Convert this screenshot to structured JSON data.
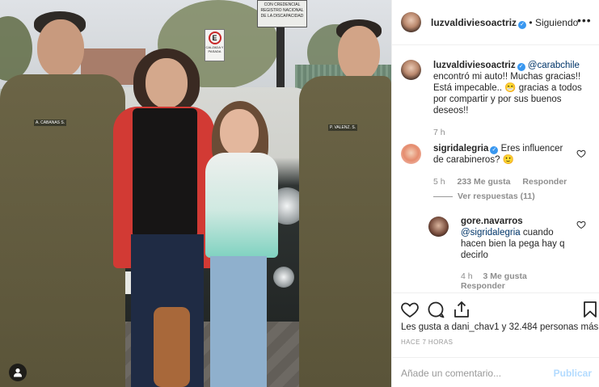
{
  "post": {
    "username": "luzvaldiviesoactriz",
    "follow_separator": "•",
    "follow_label": "Siguiendo",
    "more_glyph": "•••",
    "caption_mention": "@carabchile",
    "caption_text": "encontró mi auto!! Muchas gracias!! Está impecable.. 😁 gracias a todos por compartir y por sus buenos deseos!!",
    "caption_time": "7 h"
  },
  "photo": {
    "sign_text": "CON CREDENCIAL REGISTRO NACIONAL DE LA DISCAPACIDAD",
    "no_parking_letter": "E",
    "no_parking_text": "CALZADA Y PASADA",
    "badge_left": "A. CABANAS S.",
    "badge_right": "P. VALENZ. S."
  },
  "comments": [
    {
      "username": "sigridalegria",
      "text": "Eres influencer de carabineros? 🙂",
      "time": "5 h",
      "likes": "233 Me gusta",
      "reply": "Responder",
      "view_replies": "Ver respuestas (11)"
    },
    {
      "username": "gore.navarros",
      "mention": "@sigridalegria",
      "text": "cuando hacen bien la pega hay q decirlo",
      "time": "4 h",
      "likes": "3 Me gusta",
      "reply": "Responder"
    }
  ],
  "footer": {
    "likes_prefix": "Les gusta a ",
    "likes_user": "dani_chav1",
    "likes_suffix": " y 32.484 personas más",
    "time_ago": "HACE 7 HORAS",
    "comment_placeholder": "Añade un comentario...",
    "publish_label": "Publicar"
  },
  "colors": {
    "verified": "#3897f0",
    "mention": "#003569",
    "publish_disabled": "#b3dbff",
    "muted": "#8e8e8e"
  },
  "icons": {
    "like": "heart-icon",
    "comment": "comment-icon",
    "share": "share-icon",
    "save": "bookmark-icon",
    "tag": "user-tag-icon",
    "comment_like": "heart-icon"
  }
}
